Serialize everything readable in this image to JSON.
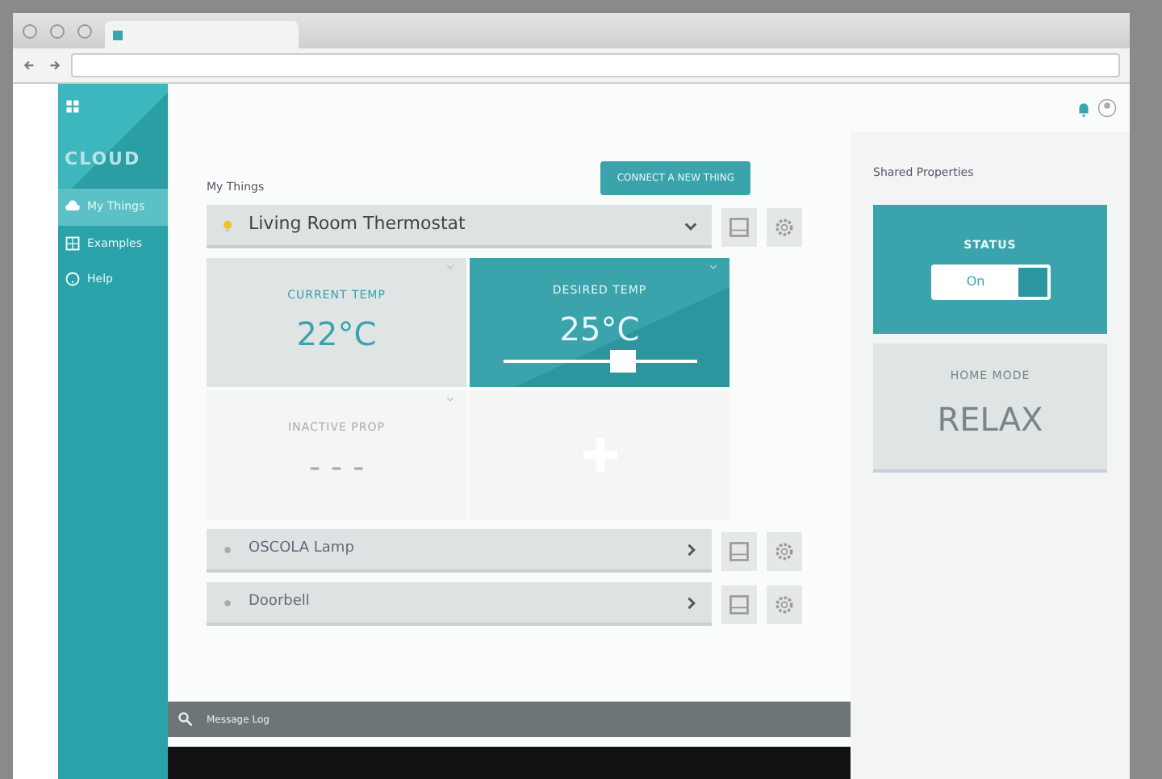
{
  "sidebar": {
    "logo": "CLOUD",
    "items": [
      {
        "label": "My Things",
        "selected": true
      },
      {
        "label": "Examples",
        "selected": false
      },
      {
        "label": "Help",
        "selected": false
      }
    ]
  },
  "main": {
    "section_title": "My Things",
    "connect_button": "CONNECT A NEW THING",
    "things": [
      {
        "name": "Living Room Thermostat",
        "expanded": true,
        "properties": [
          {
            "kind": "reading",
            "title": "CURRENT TEMP",
            "value": "22°C",
            "active": true
          },
          {
            "kind": "slider",
            "title": "DESIRED TEMP",
            "value": "25°C",
            "level": 0.62
          },
          {
            "kind": "reading",
            "title": "INACTIVE PROP",
            "value": "- - -",
            "active": false
          },
          {
            "kind": "add"
          }
        ]
      },
      {
        "name": "OSCOLA Lamp",
        "expanded": false
      },
      {
        "name": "Doorbell",
        "expanded": false
      }
    ],
    "message_log": "Message Log"
  },
  "shared": {
    "title": "Shared Properties",
    "properties": [
      {
        "kind": "toggle",
        "title": "STATUS",
        "value": "On",
        "on": true
      },
      {
        "kind": "reading",
        "title": "HOME MODE",
        "value": "RELAX"
      }
    ]
  }
}
